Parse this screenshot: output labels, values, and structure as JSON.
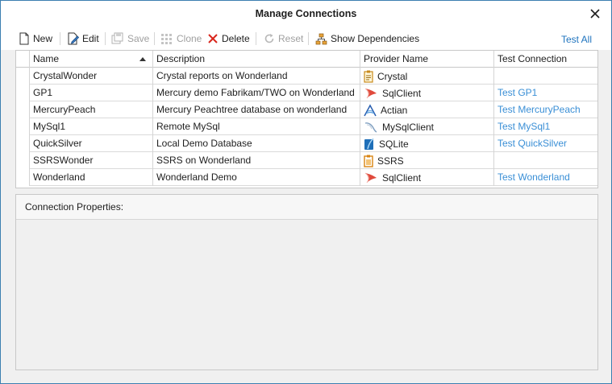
{
  "window": {
    "title": "Manage Connections",
    "close_icon": "close-icon"
  },
  "toolbar": {
    "new_label": "New",
    "edit_label": "Edit",
    "save_label": "Save",
    "clone_label": "Clone",
    "delete_label": "Delete",
    "reset_label": "Reset",
    "show_dependencies_label": "Show Dependencies",
    "test_all_label": "Test All"
  },
  "grid": {
    "columns": [
      "Name",
      "Description",
      "Provider Name",
      "Test Connection"
    ],
    "sort": {
      "column": "Name",
      "direction": "ascending"
    },
    "rows": [
      {
        "name": "CrystalWonder",
        "description": "Crystal reports on Wonderland",
        "provider": "Crystal",
        "provider_icon": "crystal-icon",
        "test": ""
      },
      {
        "name": "GP1",
        "description": "Mercury demo Fabrikam/TWO on Wonderland",
        "provider": "SqlClient",
        "provider_icon": "sqlclient-icon",
        "test": "Test GP1"
      },
      {
        "name": "MercuryPeach",
        "description": "Mercury Peachtree database on wonderland",
        "provider": "Actian",
        "provider_icon": "actian-icon",
        "test": "Test MercuryPeach"
      },
      {
        "name": "MySql1",
        "description": "Remote MySql",
        "provider": "MySqlClient",
        "provider_icon": "mysql-icon",
        "test": "Test MySql1"
      },
      {
        "name": "QuickSilver",
        "description": "Local Demo Database",
        "provider": "SQLite",
        "provider_icon": "sqlite-icon",
        "test": "Test QuickSilver"
      },
      {
        "name": "SSRSWonder",
        "description": "SSRS on Wonderland",
        "provider": "SSRS",
        "provider_icon": "ssrs-icon",
        "test": ""
      },
      {
        "name": "Wonderland",
        "description": "Wonderland Demo",
        "provider": "SqlClient",
        "provider_icon": "sqlclient-icon",
        "test": "Test Wonderland"
      }
    ]
  },
  "properties": {
    "header": "Connection Properties:"
  },
  "colors": {
    "link": "#3a8fd6",
    "test_all": "#1e73be",
    "delete_red": "#d9261c",
    "border": "#c8c8c8"
  }
}
